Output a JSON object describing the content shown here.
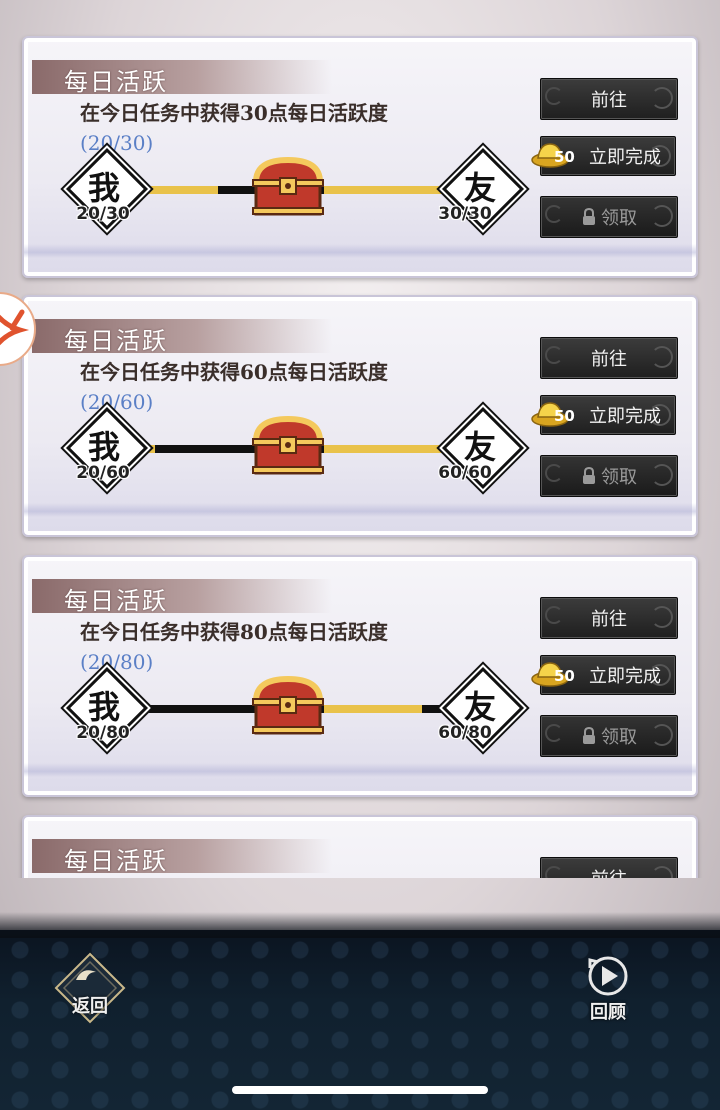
{
  "quests": [
    {
      "title": "每日活跃",
      "description": "在今日任务中获得30点每日活跃度",
      "progress_text": "(20/30)",
      "left_char": "我",
      "left_count": "20/30",
      "right_char": "友",
      "right_count": "30/30",
      "left_progress_fraction": 0.24,
      "right_progress_fraction": 1.0,
      "go_label": "前往",
      "instant_cost": "50",
      "instant_label": "立即完成",
      "claim_label": "领取"
    },
    {
      "title": "每日活跃",
      "description": "在今日任务中获得60点每日活跃度",
      "progress_text": "(20/60)",
      "left_char": "我",
      "left_count": "20/60",
      "right_char": "友",
      "right_count": "60/60",
      "left_progress_fraction": 0.08,
      "right_progress_fraction": 1.0,
      "go_label": "前往",
      "instant_cost": "50",
      "instant_label": "立即完成",
      "claim_label": "领取"
    },
    {
      "title": "每日活跃",
      "description": "在今日任务中获得80点每日活跃度",
      "progress_text": "(20/80)",
      "left_char": "我",
      "left_count": "20/80",
      "right_char": "友",
      "right_count": "60/80",
      "left_progress_fraction": 0.05,
      "right_progress_fraction": 0.75,
      "go_label": "前往",
      "instant_cost": "50",
      "instant_label": "立即完成",
      "claim_label": "领取"
    },
    {
      "title": "每日活跃",
      "go_label": "前往"
    }
  ],
  "nav": {
    "back_label": "返回",
    "review_label": "回顾"
  },
  "colors": {
    "progress_fill": "#e9c24a",
    "progress_track": "#111111",
    "progress_text": "#5a7fc6",
    "bottom_bar": "#10202e"
  }
}
